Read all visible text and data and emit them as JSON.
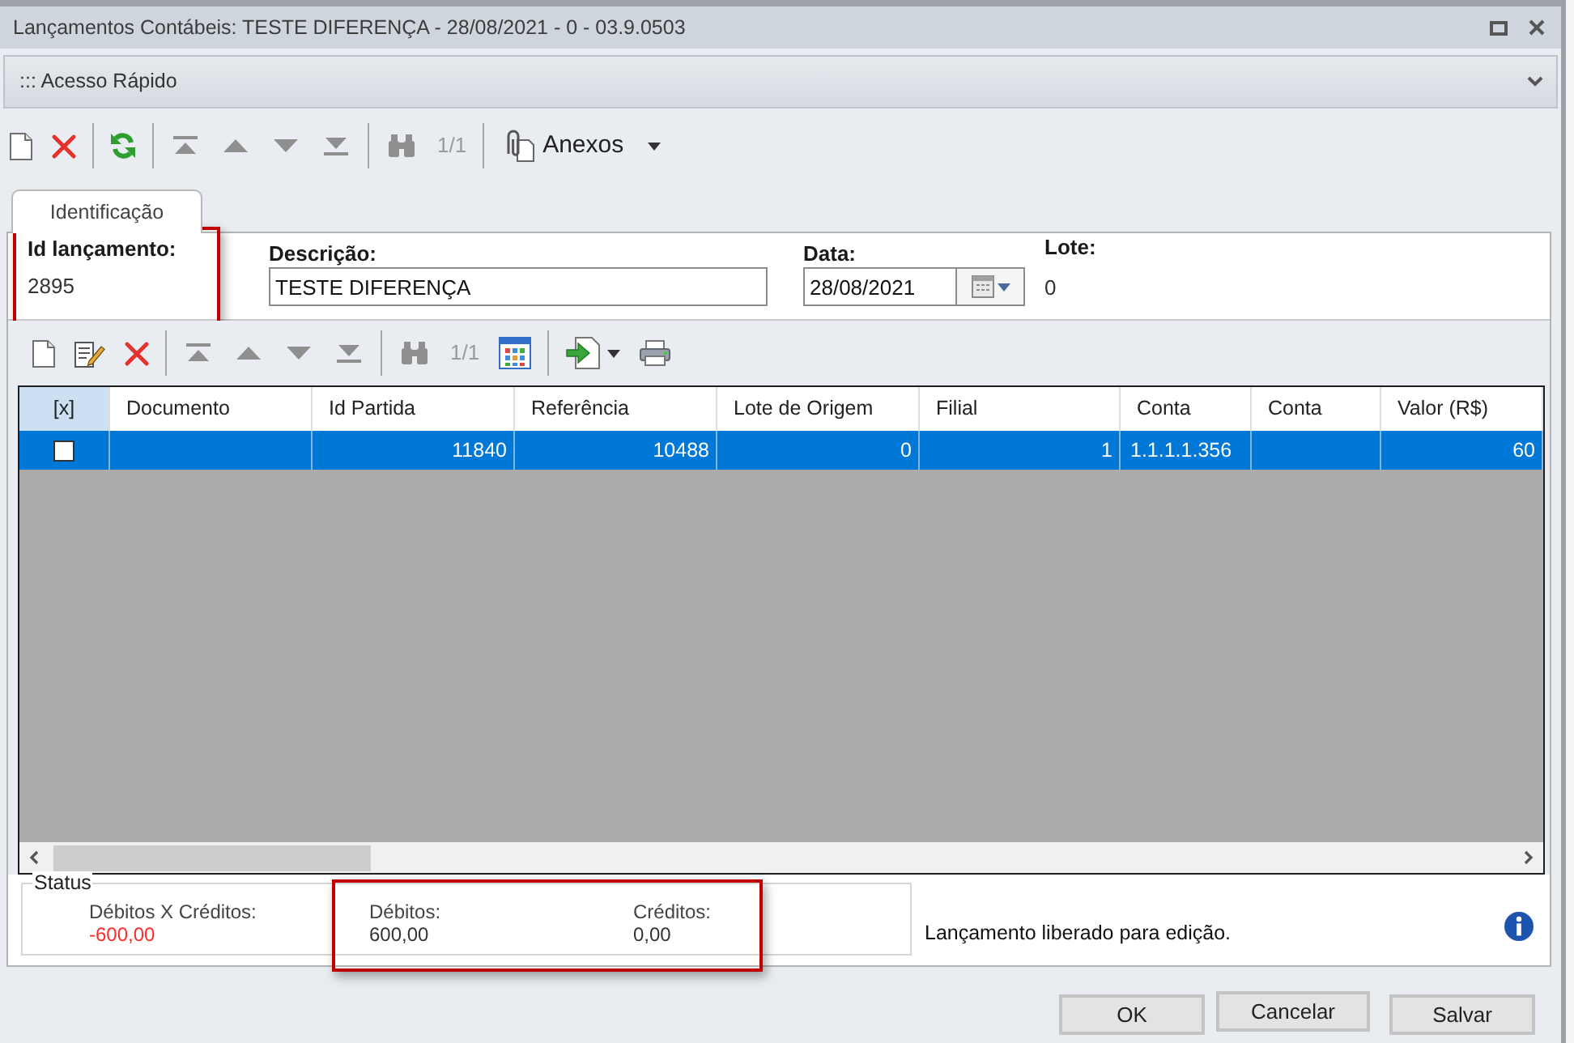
{
  "window": {
    "title": "Lançamentos Contábeis: TESTE DIFERENÇA - 28/08/2021 - 0 - 03.9.0503"
  },
  "quick_access": {
    "label": "::: Acesso Rápido"
  },
  "toolbar": {
    "groups": [
      [
        {
          "kind": "new",
          "disabled": false
        },
        {
          "kind": "delete",
          "disabled": false
        }
      ],
      [
        {
          "kind": "refresh",
          "disabled": false
        }
      ],
      [
        {
          "kind": "first",
          "disabled": true
        },
        {
          "kind": "previous",
          "disabled": true
        },
        {
          "kind": "next",
          "disabled": true
        },
        {
          "kind": "last",
          "disabled": true
        }
      ],
      [
        {
          "kind": "search",
          "disabled": true
        },
        {
          "kind": "counter",
          "text": "1/1",
          "disabled": true
        }
      ],
      [
        {
          "kind": "attachments",
          "label": "Anexos",
          "disabled": false
        }
      ]
    ]
  },
  "tabs": [
    {
      "label": "Identificação",
      "selected": true
    }
  ],
  "fields": [
    {
      "kind": "readonly",
      "label": "Id lançamento:",
      "value": "2895",
      "highlighted": true
    },
    {
      "kind": "text",
      "label": "Descrição:",
      "value": "TESTE DIFERENÇA",
      "highlighted": false
    },
    {
      "kind": "date",
      "label": "Data:",
      "value": "28/08/2021",
      "highlighted": false
    },
    {
      "kind": "readonly",
      "label": "Lote:",
      "value": "0",
      "highlighted": false
    }
  ],
  "grid_toolbar": {
    "groups": [
      [
        {
          "kind": "new",
          "disabled": false
        },
        {
          "kind": "edit",
          "disabled": false
        },
        {
          "kind": "delete",
          "disabled": false
        }
      ],
      [
        {
          "kind": "first",
          "disabled": true
        },
        {
          "kind": "previous",
          "disabled": true
        },
        {
          "kind": "next",
          "disabled": true
        },
        {
          "kind": "last",
          "disabled": true
        }
      ],
      [
        {
          "kind": "search",
          "disabled": true
        },
        {
          "kind": "counter",
          "text": "1/1",
          "disabled": true
        },
        {
          "kind": "columns",
          "disabled": false
        }
      ],
      [
        {
          "kind": "export",
          "disabled": false
        },
        {
          "kind": "print",
          "disabled": false
        }
      ]
    ]
  },
  "grid": {
    "columns": [
      "[x]",
      "Documento",
      "Id Partida",
      "Referência",
      "Lote de Origem",
      "Filial",
      "Conta",
      "Conta",
      "Valor (R$)"
    ],
    "rows": [
      {
        "selected": true,
        "checked": false,
        "cells": [
          "",
          "",
          "11840",
          "10488",
          "0",
          "1",
          "1.1.1.1.356",
          "",
          "60"
        ]
      }
    ]
  },
  "status": {
    "title": "Status",
    "balance": {
      "label": "Débitos X Créditos:",
      "value": "-600,00",
      "negative": true
    },
    "totals": {
      "highlighted": true,
      "items": [
        {
          "label": "Débitos:",
          "value": "600,00"
        },
        {
          "label": "Créditos:",
          "value": "0,00"
        }
      ]
    },
    "message": "Lançamento liberado para edição."
  },
  "buttons": [
    "OK",
    "Cancelar",
    "Salvar"
  ]
}
